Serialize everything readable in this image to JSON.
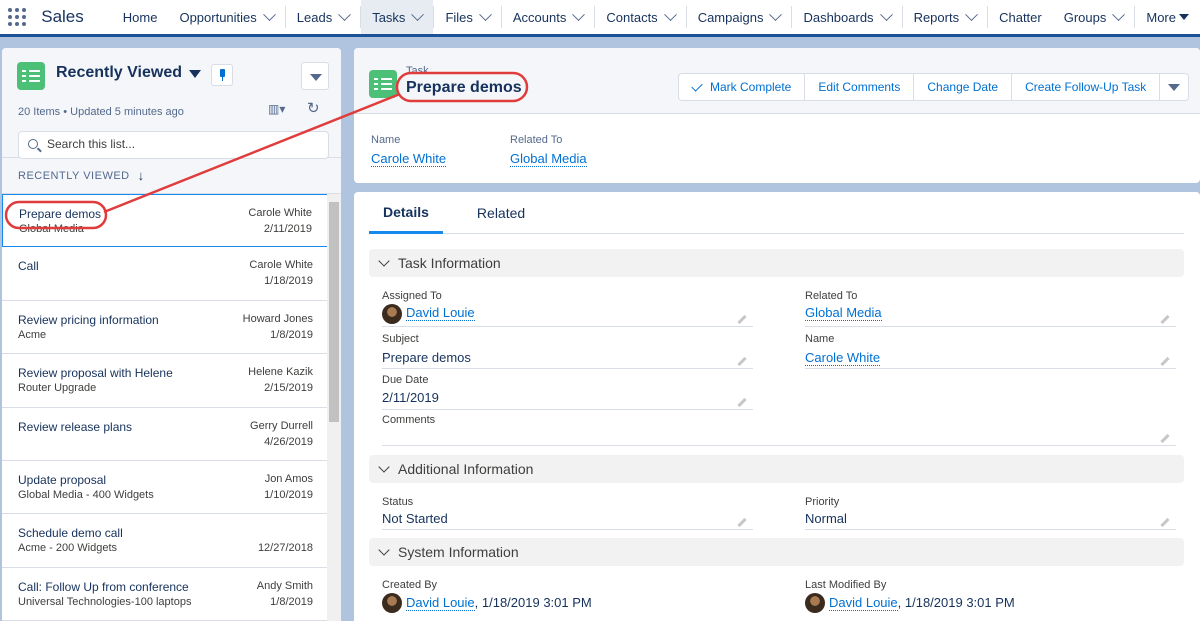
{
  "app": {
    "name": "Sales"
  },
  "nav": {
    "items": [
      {
        "label": "Home",
        "has_menu": false
      },
      {
        "label": "Opportunities",
        "has_menu": true
      },
      {
        "label": "Leads",
        "has_menu": true
      },
      {
        "label": "Tasks",
        "has_menu": true,
        "active": true
      },
      {
        "label": "Files",
        "has_menu": true
      },
      {
        "label": "Accounts",
        "has_menu": true
      },
      {
        "label": "Contacts",
        "has_menu": true
      },
      {
        "label": "Campaigns",
        "has_menu": true
      },
      {
        "label": "Dashboards",
        "has_menu": true
      },
      {
        "label": "Reports",
        "has_menu": true
      },
      {
        "label": "Chatter",
        "has_menu": false
      },
      {
        "label": "Groups",
        "has_menu": true
      },
      {
        "label": "More",
        "has_menu": false,
        "caret": true
      }
    ]
  },
  "list_view": {
    "title": "Recently Viewed",
    "meta": "20 Items • Updated 5 minutes ago",
    "search_placeholder": "Search this list...",
    "column_header": "RECENTLY VIEWED",
    "sort_arrow": "↓",
    "view_icon": "▥▾",
    "refresh_icon": "↻",
    "rows": [
      {
        "subject": "Prepare demos",
        "related": "Global Media",
        "name": "Carole White",
        "date": "2/11/2019",
        "selected": true
      },
      {
        "subject": "Call",
        "related": "",
        "name": "Carole White",
        "date": "1/18/2019"
      },
      {
        "subject": "Review pricing information",
        "related": "Acme",
        "name": "Howard Jones",
        "date": "1/8/2019"
      },
      {
        "subject": "Review proposal with Helene",
        "related": "Router Upgrade",
        "name": "Helene Kazik",
        "date": "2/15/2019"
      },
      {
        "subject": "Review release plans",
        "related": "",
        "name": "Gerry Durrell",
        "date": "4/26/2019"
      },
      {
        "subject": "Update proposal",
        "related": "Global Media - 400 Widgets",
        "name": "Jon Amos",
        "date": "1/10/2019"
      },
      {
        "subject": "Schedule demo call",
        "related": "Acme - 200 Widgets",
        "name": "",
        "date": "12/27/2018"
      },
      {
        "subject": "Call: Follow Up from conference",
        "related": "Universal Technologies-100 laptops",
        "name": "Andy Smith",
        "date": "1/8/2019"
      }
    ]
  },
  "record": {
    "type": "Task",
    "title": "Prepare demos",
    "actions": {
      "mark_complete": "Mark Complete",
      "edit_comments": "Edit Comments",
      "change_date": "Change Date",
      "follow_up": "Create Follow-Up Task"
    },
    "highlights": {
      "name_label": "Name",
      "name_value": "Carole White",
      "related_label": "Related To",
      "related_value": "Global Media"
    },
    "tabs": {
      "details": "Details",
      "related": "Related"
    },
    "sections": {
      "task_info": "Task Information",
      "additional_info": "Additional Information",
      "system_info": "System Information"
    },
    "fields": {
      "assigned_to_label": "Assigned To",
      "assigned_to_value": "David Louie",
      "related_to_label": "Related To",
      "related_to_value": "Global Media",
      "subject_label": "Subject",
      "subject_value": "Prepare demos",
      "name_label": "Name",
      "name_value": "Carole White",
      "due_date_label": "Due Date",
      "due_date_value": "2/11/2019",
      "comments_label": "Comments",
      "comments_value": "",
      "status_label": "Status",
      "status_value": "Not Started",
      "priority_label": "Priority",
      "priority_value": "Normal",
      "created_by_label": "Created By",
      "created_by_user": "David Louie",
      "created_by_date": ", 1/18/2019 3:01 PM",
      "modified_by_label": "Last Modified By",
      "modified_by_user": "David Louie",
      "modified_by_date": ", 1/18/2019 3:01 PM"
    }
  },
  "colors": {
    "brand_blue": "#1b5297",
    "link_blue": "#0070d2",
    "task_green": "#4bc076",
    "callout_red": "#e03c3c",
    "page_bg": "#b0c4df"
  },
  "icons": [
    "app-launcher-icon",
    "task-icon",
    "pin-icon",
    "search-icon",
    "refresh-icon",
    "view-toggle-icon",
    "chevron-down-icon",
    "check-icon",
    "pencil-icon",
    "avatar"
  ]
}
